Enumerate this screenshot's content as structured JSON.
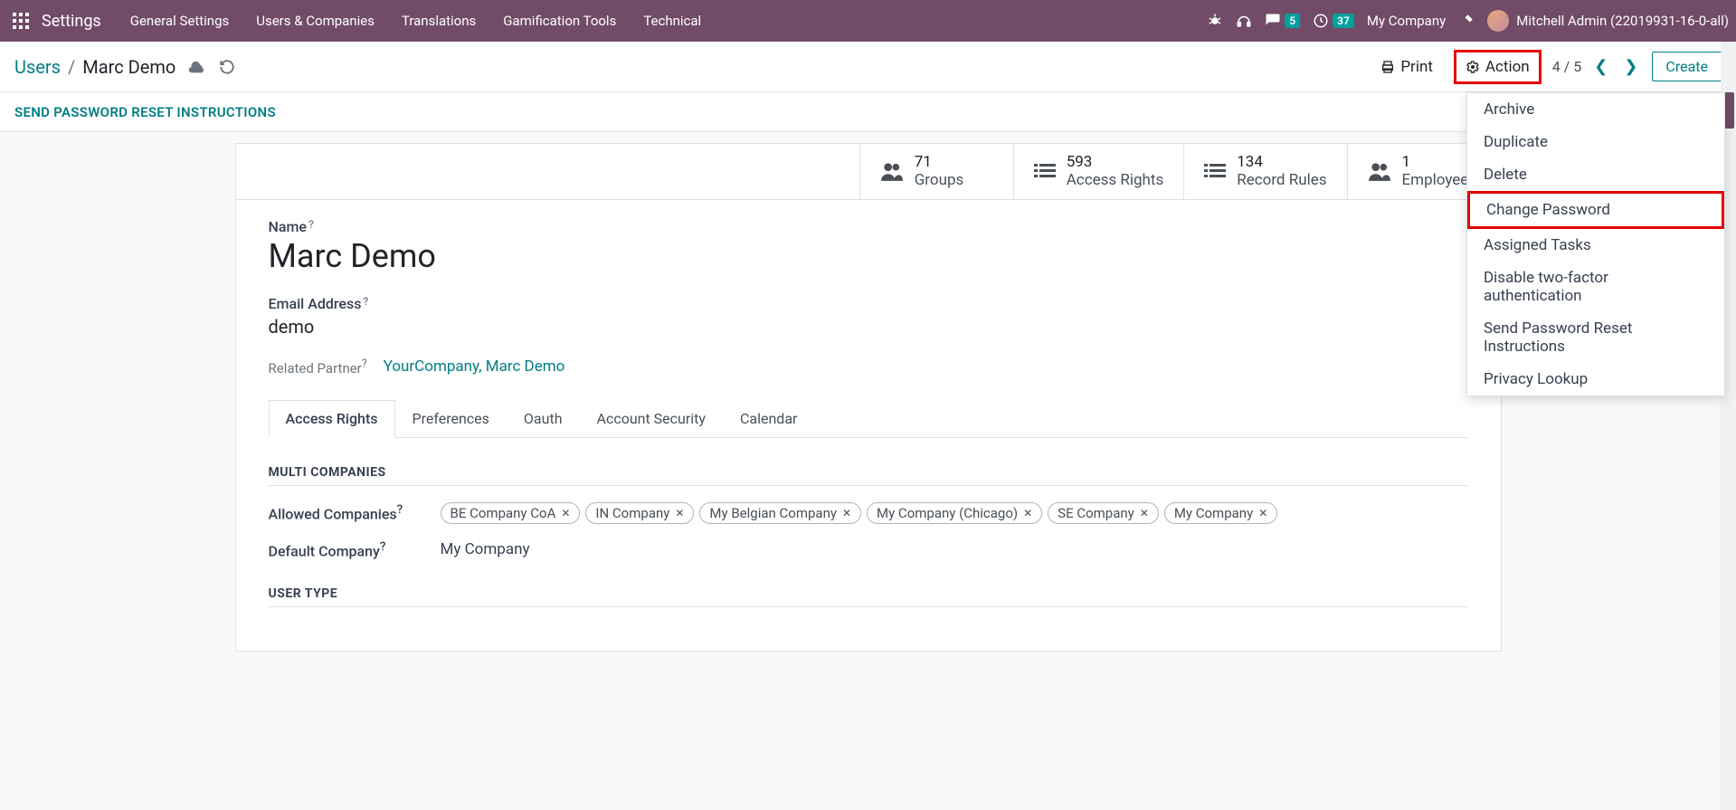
{
  "nav": {
    "app_title": "Settings",
    "menu": [
      "General Settings",
      "Users & Companies",
      "Translations",
      "Gamification Tools",
      "Technical"
    ],
    "chat_badge": "5",
    "clock_badge": "37",
    "company": "My Company",
    "user": "Mitchell Admin (22019931-16-0-all)"
  },
  "breadcrumb": {
    "root": "Users",
    "current": "Marc Demo"
  },
  "controls": {
    "print": "Print",
    "action": "Action",
    "pager": "4 / 5",
    "create": "Create"
  },
  "action_menu": [
    "Archive",
    "Duplicate",
    "Delete",
    "Change Password",
    "Assigned Tasks",
    "Disable two-factor authentication",
    "Send Password Reset Instructions",
    "Privacy Lookup"
  ],
  "status_button": "SEND PASSWORD RESET INSTRUCTIONS",
  "stats": [
    {
      "value": "71",
      "label": "Groups",
      "icon": "users"
    },
    {
      "value": "593",
      "label": "Access Rights",
      "icon": "list"
    },
    {
      "value": "134",
      "label": "Record Rules",
      "icon": "list"
    },
    {
      "value": "1",
      "label": "Employees",
      "icon": "users"
    }
  ],
  "form": {
    "name_label": "Name",
    "name_value": "Marc Demo",
    "email_label": "Email Address",
    "email_value": "demo",
    "partner_label": "Related Partner",
    "partner_value": "YourCompany, Marc Demo"
  },
  "tabs": [
    "Access Rights",
    "Preferences",
    "Oauth",
    "Account Security",
    "Calendar"
  ],
  "sections": {
    "multi_companies": {
      "title": "MULTI COMPANIES",
      "allowed_label": "Allowed Companies",
      "allowed": [
        "BE Company CoA",
        "IN Company",
        "My Belgian Company",
        "My Company (Chicago)",
        "SE Company",
        "My Company"
      ],
      "default_label": "Default Company",
      "default_value": "My Company"
    },
    "user_type": {
      "title": "USER TYPE"
    }
  }
}
